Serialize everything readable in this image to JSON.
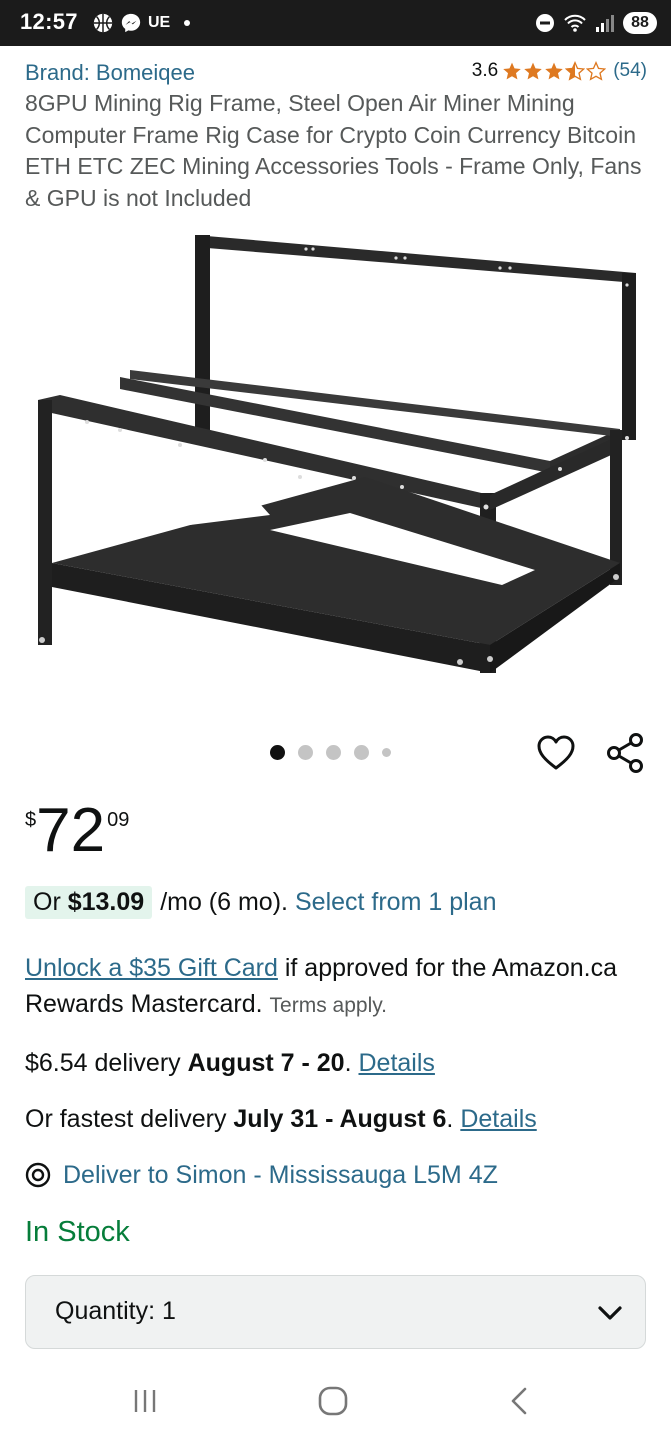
{
  "status_bar": {
    "time": "12:57",
    "carrier_tag": "UE",
    "battery": "88",
    "icons": [
      "basketball-icon",
      "messenger-icon",
      "dot-icon",
      "do-not-disturb-icon",
      "wifi-icon",
      "signal-icon",
      "battery-icon"
    ]
  },
  "product": {
    "brand": "Brand: Bomeiqee",
    "rating_value": "3.6",
    "rating_stars": 3.5,
    "rating_count": "(54)",
    "title": "8GPU Mining Rig Frame, Steel Open Air Miner Mining Computer Frame Rig Case for Crypto Coin Currency Bitcoin ETH ETC ZEC Mining Accessories Tools - Frame Only, Fans & GPU is not Included"
  },
  "gallery": {
    "dot_count": 5,
    "active_index": 0,
    "icons": [
      "heart-icon",
      "share-icon"
    ]
  },
  "price": {
    "symbol": "$",
    "whole": "72",
    "fraction": "09"
  },
  "installment": {
    "prefix": "Or ",
    "amount": "$13.09",
    "suffix": "/mo (6 mo).",
    "link": "Select from 1 plan",
    "badge_color": "#e3f4ec"
  },
  "gift": {
    "link": "Unlock a $35 Gift Card",
    "text": " if approved for the Amazon.ca Rewards Mastercard.",
    "terms": "Terms apply."
  },
  "delivery": {
    "price": "$6.54 delivery ",
    "dates": "August 7 - 20",
    "period": ". ",
    "details_link": "Details"
  },
  "fastest_delivery": {
    "prefix": "Or fastest delivery ",
    "dates": "July 31 - August 6",
    "period": ". ",
    "details_link": "Details"
  },
  "deliver_to": {
    "text": "Deliver to Simon - Mississauga L5M 4Z",
    "icon": "location-pin-icon"
  },
  "stock": {
    "text": "In Stock",
    "color": "#067d3a"
  },
  "quantity": {
    "label": "Quantity: 1",
    "icon": "chevron-down-icon"
  },
  "nav_bar": {
    "icons": [
      "recent-apps-icon",
      "home-icon",
      "back-icon"
    ]
  },
  "colors": {
    "link": "#2c6a8a",
    "star": "#de7921",
    "text": "#0f1111",
    "muted": "#565959"
  }
}
